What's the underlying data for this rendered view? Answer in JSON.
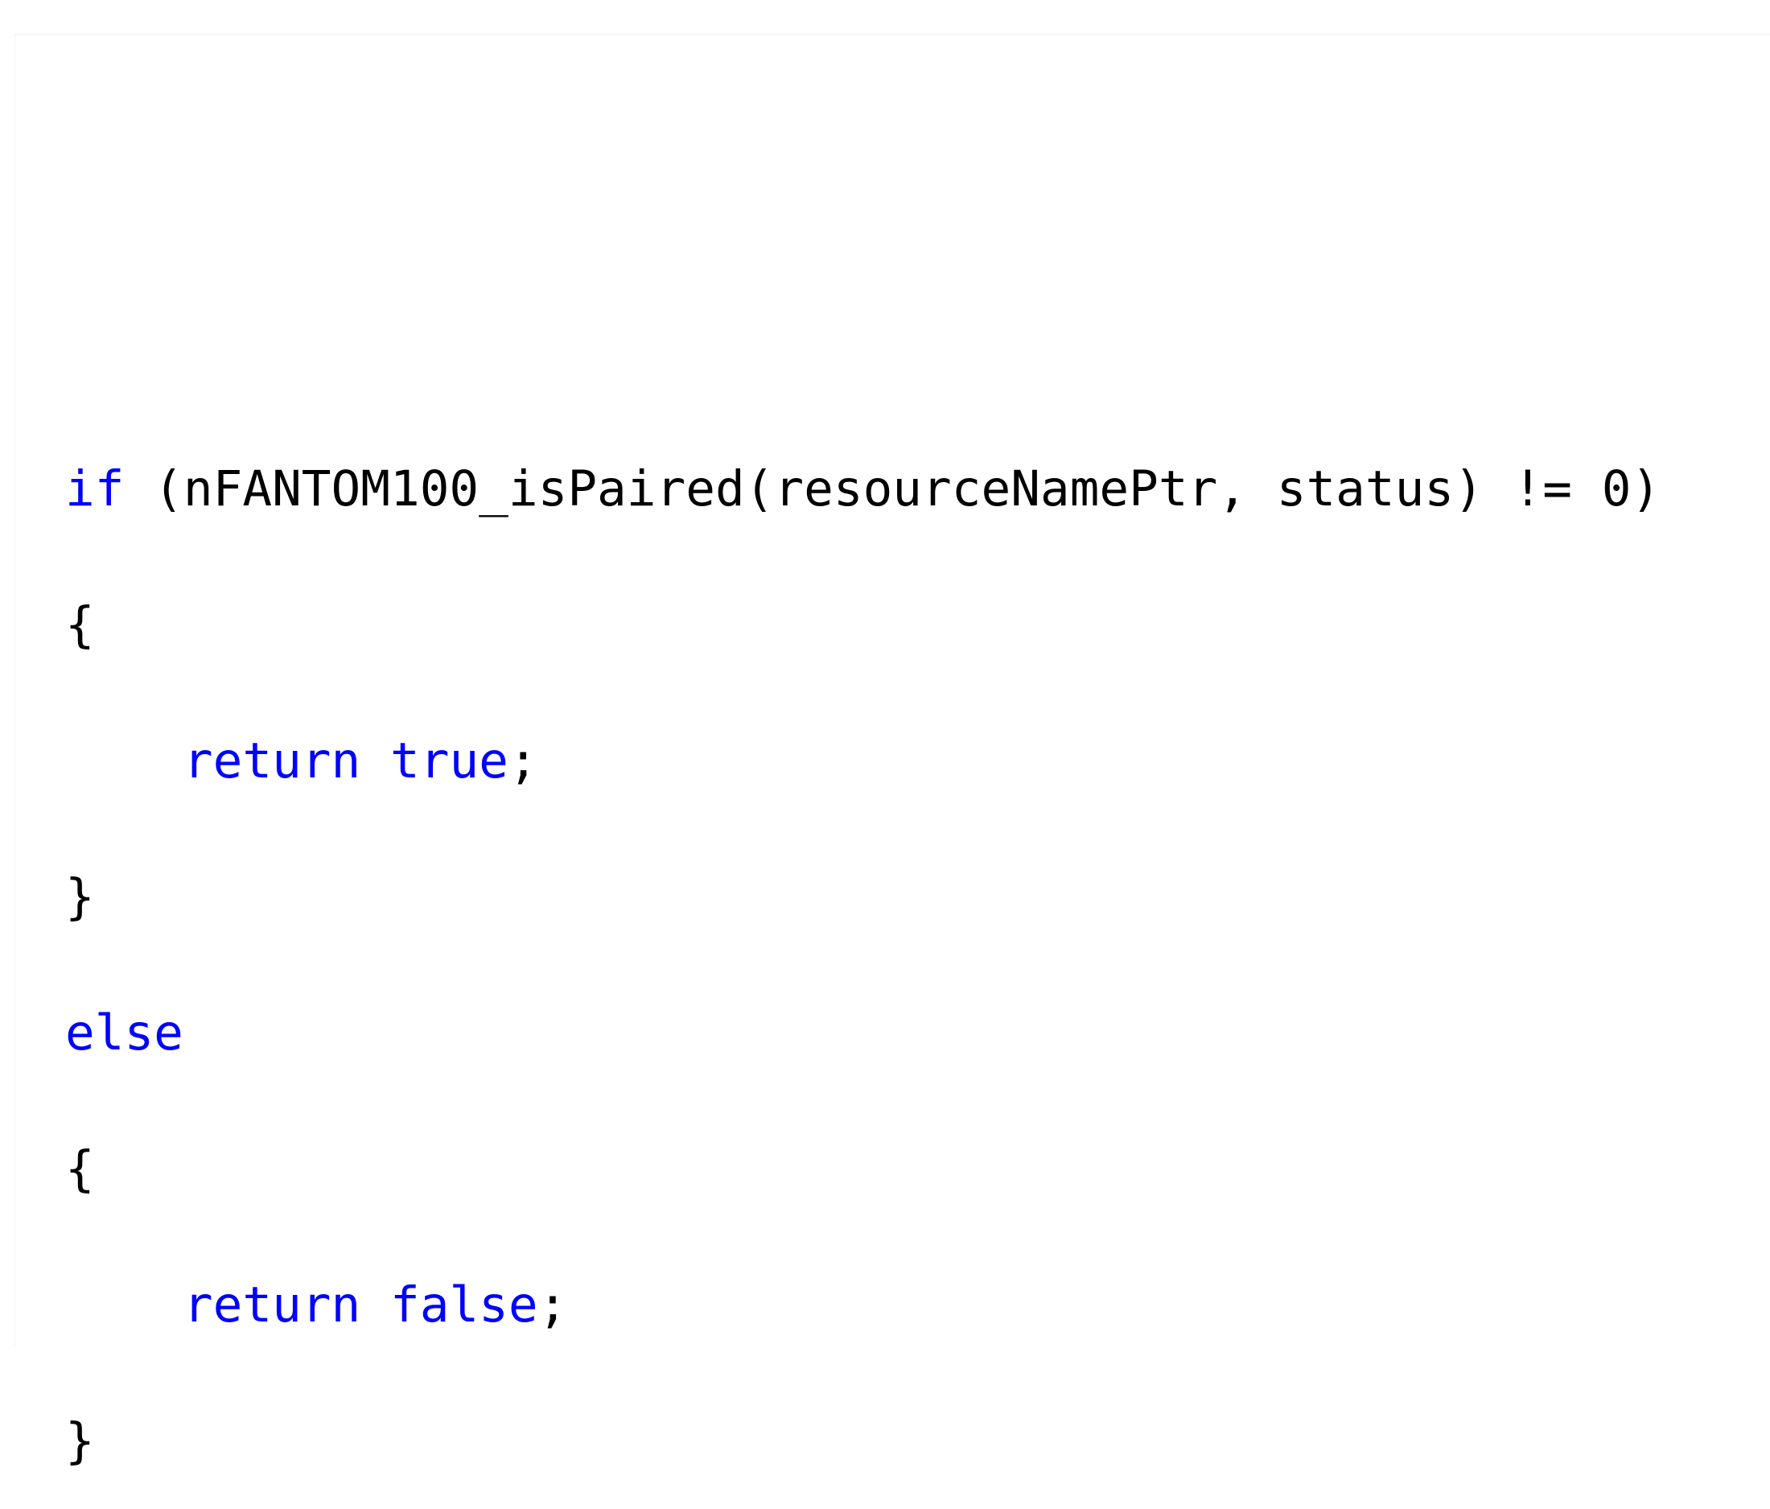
{
  "editor": {
    "lines": [
      {
        "indent": "",
        "tokens": [
          {
            "text": "if",
            "kind": "keyword"
          },
          {
            "text": " (nFANTOM100_isPaired(resourceNamePtr, status) != 0)",
            "kind": "plain"
          }
        ]
      },
      {
        "indent": "",
        "tokens": [
          {
            "text": "{",
            "kind": "plain"
          }
        ]
      },
      {
        "indent": "    ",
        "tokens": [
          {
            "text": "return",
            "kind": "keyword"
          },
          {
            "text": " ",
            "kind": "plain"
          },
          {
            "text": "true",
            "kind": "keyword"
          },
          {
            "text": ";",
            "kind": "plain"
          }
        ]
      },
      {
        "indent": "",
        "tokens": [
          {
            "text": "}",
            "kind": "plain"
          }
        ]
      },
      {
        "indent": "",
        "tokens": [
          {
            "text": "else",
            "kind": "keyword"
          }
        ]
      },
      {
        "indent": "",
        "tokens": [
          {
            "text": "{",
            "kind": "plain"
          }
        ]
      },
      {
        "indent": "    ",
        "tokens": [
          {
            "text": "return",
            "kind": "keyword"
          },
          {
            "text": " ",
            "kind": "plain"
          },
          {
            "text": "false",
            "kind": "keyword"
          },
          {
            "text": ";",
            "kind": "plain"
          }
        ]
      },
      {
        "indent": "",
        "tokens": [
          {
            "text": "}",
            "kind": "plain"
          }
        ]
      }
    ]
  },
  "colors": {
    "keyword": "#0000ff",
    "plain": "#000000",
    "background": "#ffffff"
  }
}
